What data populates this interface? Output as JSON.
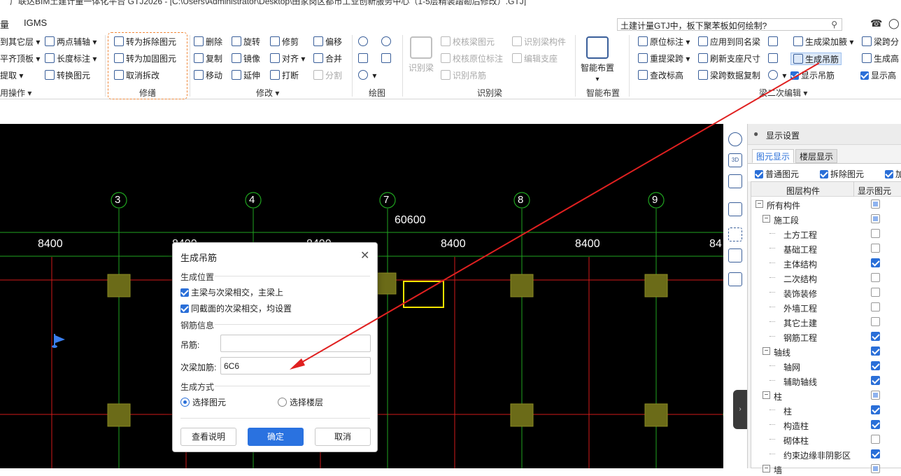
{
  "window": {
    "title": "广联达BIM土建计量一体化平台 GTJ2026 - [C:\\Users\\Administrator\\Desktop\\田家岗区都市工业创新服务中心（1-5层精装踏勘后修改）.GTJ]"
  },
  "menu": {
    "items": [
      "量",
      "IGMS"
    ]
  },
  "search": {
    "value": "土建计量GTJ中，板下聚苯板如何绘制?"
  },
  "ribbon": {
    "col0": [
      "到其它层",
      "平齐顶板",
      "提取"
    ],
    "col0_group": "用操作",
    "col1": [
      "两点辅轴",
      "长度标注",
      "转换图元"
    ],
    "repair": [
      "转为拆除图元",
      "转为加固图元",
      "取消拆改"
    ],
    "repair_group": "修缮",
    "modify_a": [
      "删除",
      "复制",
      "移动"
    ],
    "modify_b": [
      "旋转",
      "镜像",
      "延伸"
    ],
    "modify_c": [
      "修剪",
      "对齐",
      "打断"
    ],
    "modify_d": [
      "偏移",
      "合并",
      "分割"
    ],
    "modify_group": "修改",
    "draw_group": "绘图",
    "identify_big": "识别梁",
    "identify_a": [
      "校核梁图元",
      "校核原位标注",
      "识别吊筋"
    ],
    "identify_b": [
      "识别梁构件",
      "编辑支座"
    ],
    "identify_group": "识别梁",
    "smart_big": "智能布置",
    "smart_group": "智能布置",
    "beam_a": [
      "原位标注",
      "重提梁跨",
      "查改标高"
    ],
    "beam_b": [
      "应用到同名梁",
      "刷新支座尺寸",
      "梁跨数据复制"
    ],
    "beam_c": [
      "生成梁加腋",
      "生成吊筋",
      "显示吊筋"
    ],
    "beam_d": [
      "梁跨分",
      "生成高",
      "显示高"
    ],
    "beam_group": "梁二次编辑"
  },
  "canvas": {
    "axes": [
      "3",
      "4",
      "7",
      "8",
      "9"
    ],
    "total_dim": "60600",
    "spans": [
      "8400",
      "8400",
      "8400",
      "8400",
      "8400",
      "84"
    ]
  },
  "dialog": {
    "title": "生成吊筋",
    "sec_position": "生成位置",
    "chk1": "主梁与次梁相交，主梁上",
    "chk2": "同截面的次梁相交，均设置",
    "sec_rebar": "钢筋信息",
    "lbl_hanger": "吊筋:",
    "hanger_value": "",
    "lbl_secondary": "次梁加筋:",
    "secondary_value": "6C6",
    "sec_method": "生成方式",
    "radio1": "选择图元",
    "radio2": "选择楼层",
    "btn_help": "查看说明",
    "btn_ok": "确定",
    "btn_cancel": "取消"
  },
  "panel": {
    "title": "显示设置",
    "tab1": "图元显示",
    "tab2": "楼层显示",
    "filter1": "普通图元",
    "filter2": "拆除图元",
    "filter3": "加",
    "col1": "图层构件",
    "col2": "显示图元",
    "rows": [
      {
        "label": "所有构件",
        "state": "part",
        "level": 0,
        "exp": "−"
      },
      {
        "label": "施工段",
        "state": "part",
        "level": 1,
        "exp": "−"
      },
      {
        "label": "土方工程",
        "state": "off",
        "level": 2,
        "exp": ""
      },
      {
        "label": "基础工程",
        "state": "off",
        "level": 2,
        "exp": ""
      },
      {
        "label": "主体结构",
        "state": "on",
        "level": 2,
        "exp": ""
      },
      {
        "label": "二次结构",
        "state": "off",
        "level": 2,
        "exp": ""
      },
      {
        "label": "装饰装修",
        "state": "off",
        "level": 2,
        "exp": ""
      },
      {
        "label": "外墙工程",
        "state": "off",
        "level": 2,
        "exp": ""
      },
      {
        "label": "其它土建",
        "state": "off",
        "level": 2,
        "exp": ""
      },
      {
        "label": "钢筋工程",
        "state": "on",
        "level": 2,
        "exp": ""
      },
      {
        "label": "轴线",
        "state": "on",
        "level": 1,
        "exp": "−"
      },
      {
        "label": "轴网",
        "state": "on",
        "level": 2,
        "exp": ""
      },
      {
        "label": "辅助轴线",
        "state": "on",
        "level": 2,
        "exp": ""
      },
      {
        "label": "柱",
        "state": "part",
        "level": 1,
        "exp": "−"
      },
      {
        "label": "柱",
        "state": "on",
        "level": 2,
        "exp": ""
      },
      {
        "label": "构造柱",
        "state": "on",
        "level": 2,
        "exp": ""
      },
      {
        "label": "砌体柱",
        "state": "off",
        "level": 2,
        "exp": ""
      },
      {
        "label": "约束边缘非阴影区",
        "state": "on",
        "level": 2,
        "exp": ""
      },
      {
        "label": "墙",
        "state": "part",
        "level": 1,
        "exp": "−"
      }
    ]
  },
  "colors": {
    "accent": "#2a6fd8",
    "canvas_bg": "#000000",
    "axis_green": "#1fa31f",
    "grid_red": "#d21a1a",
    "column_fill": "#6b6b18",
    "highlight": "#f5e400",
    "arrow": "#e02020",
    "repair_border": "#f0883a"
  }
}
